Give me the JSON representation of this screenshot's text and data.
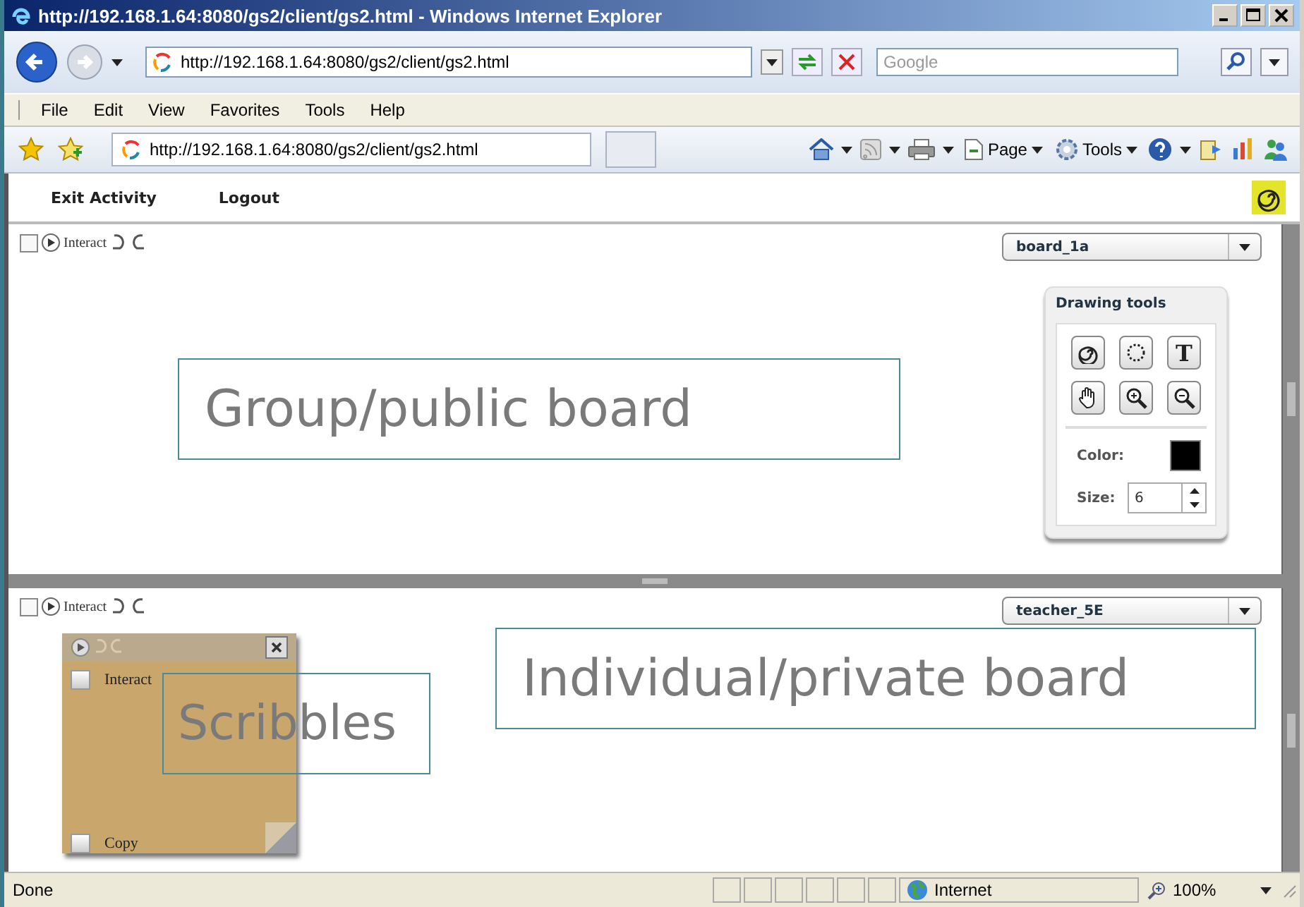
{
  "window": {
    "title": "http://192.168.1.64:8080/gs2/client/gs2.html - Windows Internet Explorer"
  },
  "address_bar": {
    "url": "http://192.168.1.64:8080/gs2/client/gs2.html"
  },
  "search": {
    "placeholder": "Google"
  },
  "menu": [
    "File",
    "Edit",
    "View",
    "Favorites",
    "Tools",
    "Help"
  ],
  "tab": {
    "title": "http://192.168.1.64:8080/gs2/client/gs2.html"
  },
  "command_bar": [
    {
      "kind": "home"
    },
    {
      "kind": "feeds"
    },
    {
      "kind": "print"
    },
    {
      "kind": "page",
      "label": "Page"
    },
    {
      "kind": "tools",
      "label": "Tools"
    },
    {
      "kind": "help"
    },
    {
      "kind": "research"
    },
    {
      "kind": "stats"
    },
    {
      "kind": "messenger"
    }
  ],
  "app_toolbar": {
    "links": [
      "Exit Activity",
      "Logout"
    ]
  },
  "boards": [
    {
      "interact_checked": false,
      "interact_label": "Interact",
      "selector": "board_1a"
    },
    {
      "interact_checked": false,
      "interact_label": "Interact",
      "selector": "teacher_5E"
    }
  ],
  "drawing_tools": {
    "title": "Drawing tools",
    "tools": [
      {
        "kind": "spiral"
      },
      {
        "kind": "lasso"
      },
      {
        "kind": "text",
        "label": "T"
      },
      {
        "kind": "hand"
      },
      {
        "kind": "zoom-in"
      },
      {
        "kind": "zoom-out"
      }
    ],
    "color_label": "Color:",
    "color": "#000000",
    "size_label": "Size:",
    "size": "6"
  },
  "sticky_note": {
    "checkboxes": [
      {
        "label": "Interact",
        "checked": false
      },
      {
        "label": "Copy",
        "checked": false
      }
    ]
  },
  "annotations": [
    "Group/public board",
    "Individual/private board",
    "Scribbles"
  ],
  "status_bar": {
    "text": "Done",
    "zone": "Internet",
    "zoom": "100%"
  }
}
